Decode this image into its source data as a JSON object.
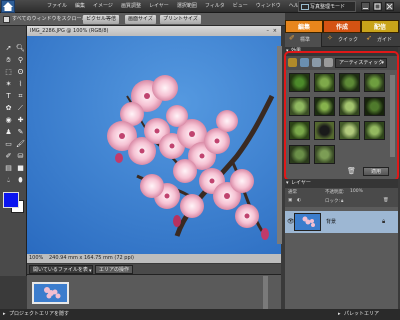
{
  "menubar": {
    "items": [
      "ファイル",
      "編集",
      "イメージ",
      "画質調整",
      "レイヤー",
      "選択範囲",
      "フィルタ",
      "ビュー",
      "ウィンドウ",
      "ヘルプ"
    ],
    "mode_label": "写真整理モード"
  },
  "options_bar": {
    "scroll_all": "すべてのウィンドウをスクロール",
    "actual_pixels": "ピクセル等倍",
    "fit_screen": "画面サイズ",
    "print_size": "プリントサイズ"
  },
  "document": {
    "title": "IMG_2286.JPG @ 100% (RGB/8)",
    "zoom": "100%",
    "info": "240.94 mm x 164.75 mm (72 ppi)"
  },
  "bin": {
    "dropdown": "開いているファイルを表示",
    "tab": "エリアの操作"
  },
  "bottombar": {
    "left": "プロジェクトエリアを隠す",
    "right": "パレットエリア"
  },
  "modes": {
    "tabs": [
      "編集",
      "作成",
      "配信"
    ],
    "colors": [
      "#e8861c",
      "#d45313",
      "#c9a41a"
    ]
  },
  "subtabs": [
    "標準",
    "クイック",
    "ガイド"
  ],
  "effects": {
    "header": "効果",
    "dropdown": "アーティスティック",
    "apply": "適用"
  },
  "layers": {
    "header": "レイヤー",
    "blend": "通常",
    "opacity_label": "不透明度:",
    "opacity": "100%",
    "lock_label": "ロック:",
    "layer_name": "背景"
  },
  "foreground_color": "#0a14f0",
  "background_color": "#ffffff"
}
